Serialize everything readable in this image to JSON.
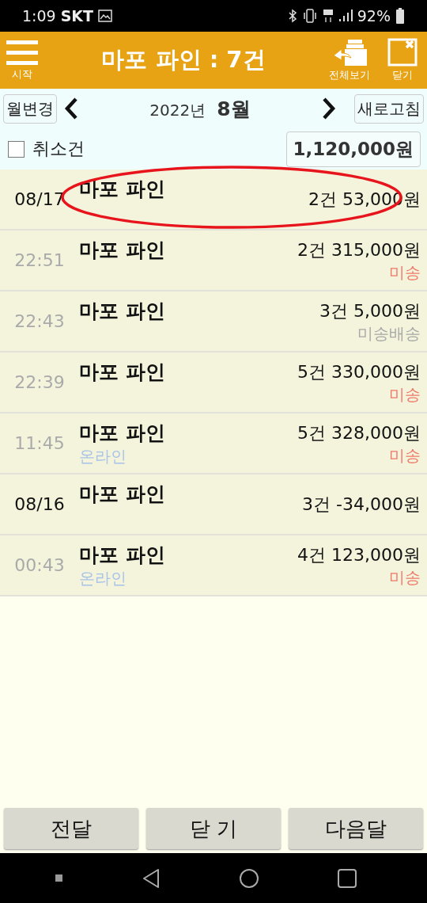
{
  "status_bar": {
    "time": "1:09",
    "carrier": "SKT",
    "battery": "92%"
  },
  "header": {
    "menu_label": "시작",
    "title": "마포 파인 : 7건",
    "view_all_label": "전체보기",
    "close_label": "닫기"
  },
  "nav": {
    "change_month": "월변경",
    "year": "2022년",
    "month": "8월",
    "refresh": "새로고침"
  },
  "filter": {
    "label": "취소건",
    "checked": false,
    "total": "1,120,000원"
  },
  "rows": [
    {
      "kind": "date",
      "when": "08/17",
      "name": "마포 파인",
      "amount": "2건 53,000원",
      "circled": true
    },
    {
      "kind": "time",
      "when": "22:51",
      "name": "마포 파인",
      "amount": "2건 315,000원",
      "status": "미송",
      "color": "#f07a6a"
    },
    {
      "kind": "time",
      "when": "22:43",
      "name": "마포 파인",
      "amount": "3건 5,000원",
      "status": "미송배송",
      "color": "#a8a8a8"
    },
    {
      "kind": "time",
      "when": "22:39",
      "name": "마포 파인",
      "amount": "5건 330,000원",
      "status": "미송",
      "color": "#f07a6a"
    },
    {
      "kind": "time",
      "when": "11:45",
      "name": "마포 파인",
      "channel": "온라인",
      "amount": "5건 328,000원",
      "status": "미송",
      "color": "#f07a6a"
    },
    {
      "kind": "date",
      "when": "08/16",
      "name": "마포 파인",
      "amount": "3건 -34,000원"
    },
    {
      "kind": "time",
      "when": "00:43",
      "name": "마포 파인",
      "channel": "온라인",
      "amount": "4건 123,000원",
      "status": "미송",
      "color": "#f07a6a"
    }
  ],
  "footer_buttons": [
    "전달",
    "닫 기",
    "다음달"
  ]
}
